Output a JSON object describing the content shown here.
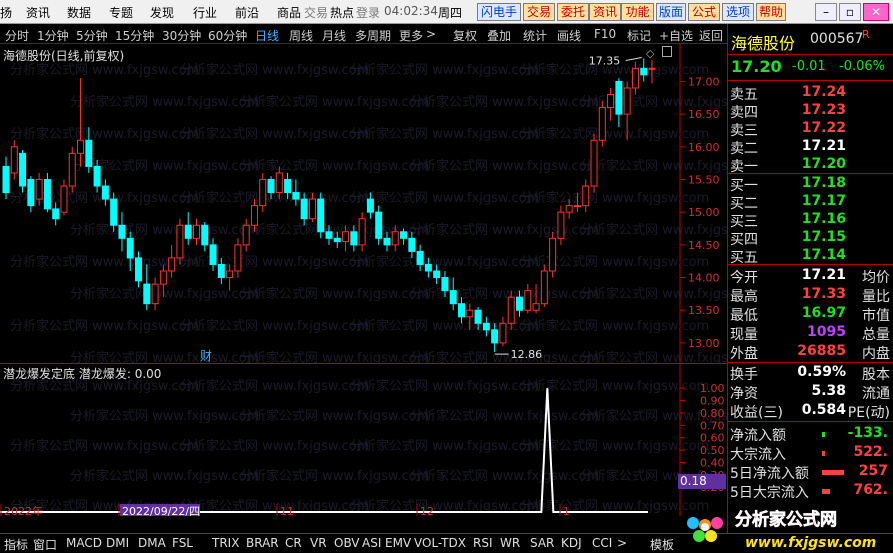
{
  "menubar": {
    "items": [
      "扬",
      "资讯",
      "数据",
      "专题",
      "发现",
      "行业",
      "前沿",
      "商品",
      "交易",
      "热点",
      "登录"
    ],
    "time": "04:02:34",
    "weekday": "周四",
    "buttons": [
      {
        "label": "闪电手",
        "bg": "#dde8ff",
        "fg": "#0040c0"
      },
      {
        "label": "交易",
        "bg": "#ffe0a0",
        "fg": "#c00000"
      },
      {
        "label": "委托",
        "bg": "#ffe0a0",
        "fg": "#c00000"
      },
      {
        "label": "资讯",
        "bg": "#ffe0a0",
        "fg": "#c00000"
      },
      {
        "label": "功能",
        "bg": "#ffe0a0",
        "fg": "#c00000"
      },
      {
        "label": "版面",
        "bg": "#dde8ff",
        "fg": "#0040c0"
      },
      {
        "label": "公式",
        "bg": "#ffe0a0",
        "fg": "#c00000"
      },
      {
        "label": "选项",
        "bg": "#dde8ff",
        "fg": "#0040c0"
      },
      {
        "label": "帮助",
        "bg": "#ffe0a0",
        "fg": "#c00000"
      }
    ],
    "window_controls": [
      "minimize-icon",
      "restore-icon",
      "close-icon"
    ]
  },
  "periodbar": {
    "periods": [
      "分时",
      "1分钟",
      "5分钟",
      "15分钟",
      "30分钟",
      "60分钟",
      "日线",
      "周线",
      "月线",
      "多周期",
      "更多"
    ],
    "active": "日线",
    "more_symbol": ">",
    "tools": [
      "复权",
      "叠加",
      "统计",
      "画线",
      "F10",
      "标记",
      "+自选",
      "返回"
    ]
  },
  "chart": {
    "title": "海德股份(日线,前复权)",
    "y_ticks": [
      "17.00",
      "16.50",
      "16.00",
      "15.50",
      "15.00",
      "14.50",
      "14.00",
      "13.50",
      "13.00"
    ],
    "high_marker": "17.35",
    "low_marker": "12.86",
    "cai_badge": "财",
    "up_color": "#ff3030",
    "down_color": "#00ffff"
  },
  "chart_data": {
    "type": "candlestick",
    "title": "海德股份(日线,前复权)",
    "ylim": [
      12.8,
      17.45
    ],
    "candles": [
      {
        "o": 15.7,
        "h": 15.85,
        "l": 15.2,
        "c": 15.3
      },
      {
        "o": 15.6,
        "h": 16.1,
        "l": 15.5,
        "c": 16.0
      },
      {
        "o": 15.9,
        "h": 15.95,
        "l": 15.3,
        "c": 15.4
      },
      {
        "o": 15.5,
        "h": 15.55,
        "l": 15.0,
        "c": 15.1
      },
      {
        "o": 15.2,
        "h": 15.6,
        "l": 15.1,
        "c": 15.5
      },
      {
        "o": 15.5,
        "h": 15.6,
        "l": 15.0,
        "c": 15.05
      },
      {
        "o": 15.05,
        "h": 15.15,
        "l": 14.8,
        "c": 14.9
      },
      {
        "o": 15.0,
        "h": 15.5,
        "l": 14.95,
        "c": 15.4
      },
      {
        "o": 15.4,
        "h": 16.0,
        "l": 15.3,
        "c": 15.9
      },
      {
        "o": 15.9,
        "h": 17.05,
        "l": 15.7,
        "c": 16.1
      },
      {
        "o": 16.1,
        "h": 16.3,
        "l": 15.6,
        "c": 15.7
      },
      {
        "o": 15.7,
        "h": 15.8,
        "l": 15.3,
        "c": 15.4
      },
      {
        "o": 15.4,
        "h": 15.5,
        "l": 15.1,
        "c": 15.2
      },
      {
        "o": 15.2,
        "h": 15.3,
        "l": 14.7,
        "c": 14.8
      },
      {
        "o": 14.8,
        "h": 15.0,
        "l": 14.4,
        "c": 14.6
      },
      {
        "o": 14.6,
        "h": 14.7,
        "l": 14.1,
        "c": 14.3
      },
      {
        "o": 14.3,
        "h": 14.4,
        "l": 13.85,
        "c": 13.95
      },
      {
        "o": 13.9,
        "h": 14.2,
        "l": 13.5,
        "c": 13.6
      },
      {
        "o": 13.6,
        "h": 14.0,
        "l": 13.5,
        "c": 13.9
      },
      {
        "o": 13.9,
        "h": 14.2,
        "l": 13.7,
        "c": 14.1
      },
      {
        "o": 14.1,
        "h": 14.5,
        "l": 14.0,
        "c": 14.3
      },
      {
        "o": 14.3,
        "h": 14.9,
        "l": 14.2,
        "c": 14.8
      },
      {
        "o": 14.8,
        "h": 15.0,
        "l": 14.5,
        "c": 14.6
      },
      {
        "o": 14.6,
        "h": 14.9,
        "l": 14.5,
        "c": 14.8
      },
      {
        "o": 14.8,
        "h": 14.85,
        "l": 14.4,
        "c": 14.5
      },
      {
        "o": 14.5,
        "h": 14.6,
        "l": 14.1,
        "c": 14.2
      },
      {
        "o": 14.2,
        "h": 14.3,
        "l": 13.9,
        "c": 14.0
      },
      {
        "o": 14.0,
        "h": 14.2,
        "l": 13.8,
        "c": 14.1
      },
      {
        "o": 14.1,
        "h": 14.6,
        "l": 14.0,
        "c": 14.5
      },
      {
        "o": 14.5,
        "h": 14.9,
        "l": 14.4,
        "c": 14.8
      },
      {
        "o": 14.8,
        "h": 15.2,
        "l": 14.7,
        "c": 15.1
      },
      {
        "o": 15.1,
        "h": 15.6,
        "l": 15.0,
        "c": 15.5
      },
      {
        "o": 15.5,
        "h": 15.55,
        "l": 15.2,
        "c": 15.3
      },
      {
        "o": 15.3,
        "h": 15.7,
        "l": 15.2,
        "c": 15.6
      },
      {
        "o": 15.5,
        "h": 15.6,
        "l": 15.2,
        "c": 15.3
      },
      {
        "o": 15.3,
        "h": 15.5,
        "l": 15.1,
        "c": 15.2
      },
      {
        "o": 15.2,
        "h": 15.3,
        "l": 14.8,
        "c": 14.9
      },
      {
        "o": 14.9,
        "h": 15.3,
        "l": 14.85,
        "c": 15.2
      },
      {
        "o": 15.2,
        "h": 15.3,
        "l": 14.6,
        "c": 14.7
      },
      {
        "o": 14.7,
        "h": 14.8,
        "l": 14.5,
        "c": 14.6
      },
      {
        "o": 14.6,
        "h": 14.7,
        "l": 14.45,
        "c": 14.55
      },
      {
        "o": 14.55,
        "h": 14.8,
        "l": 14.4,
        "c": 14.7
      },
      {
        "o": 14.7,
        "h": 14.8,
        "l": 14.4,
        "c": 14.5
      },
      {
        "o": 14.5,
        "h": 15.0,
        "l": 14.4,
        "c": 14.9
      },
      {
        "o": 15.2,
        "h": 15.3,
        "l": 14.9,
        "c": 15.0
      },
      {
        "o": 15.0,
        "h": 15.1,
        "l": 14.5,
        "c": 14.6
      },
      {
        "o": 14.6,
        "h": 14.7,
        "l": 14.4,
        "c": 14.5
      },
      {
        "o": 14.5,
        "h": 14.8,
        "l": 14.4,
        "c": 14.7
      },
      {
        "o": 14.7,
        "h": 14.75,
        "l": 14.5,
        "c": 14.6
      },
      {
        "o": 14.6,
        "h": 14.7,
        "l": 14.3,
        "c": 14.4
      },
      {
        "o": 14.4,
        "h": 14.5,
        "l": 14.1,
        "c": 14.2
      },
      {
        "o": 14.2,
        "h": 14.3,
        "l": 14.0,
        "c": 14.1
      },
      {
        "o": 14.1,
        "h": 14.2,
        "l": 13.9,
        "c": 14.0
      },
      {
        "o": 14.0,
        "h": 14.1,
        "l": 13.7,
        "c": 13.8
      },
      {
        "o": 13.8,
        "h": 14.0,
        "l": 13.5,
        "c": 13.6
      },
      {
        "o": 13.6,
        "h": 13.7,
        "l": 13.3,
        "c": 13.4
      },
      {
        "o": 13.4,
        "h": 13.6,
        "l": 13.2,
        "c": 13.5
      },
      {
        "o": 13.5,
        "h": 13.55,
        "l": 13.2,
        "c": 13.3
      },
      {
        "o": 13.3,
        "h": 13.4,
        "l": 13.1,
        "c": 13.2
      },
      {
        "o": 13.2,
        "h": 13.3,
        "l": 12.86,
        "c": 13.0
      },
      {
        "o": 13.0,
        "h": 13.4,
        "l": 12.95,
        "c": 13.3
      },
      {
        "o": 13.3,
        "h": 13.8,
        "l": 13.2,
        "c": 13.7
      },
      {
        "o": 13.7,
        "h": 13.8,
        "l": 13.4,
        "c": 13.5
      },
      {
        "o": 13.5,
        "h": 13.9,
        "l": 13.45,
        "c": 13.8
      },
      {
        "o": 13.5,
        "h": 13.9,
        "l": 13.45,
        "c": 13.6
      },
      {
        "o": 13.6,
        "h": 14.2,
        "l": 13.55,
        "c": 14.1
      },
      {
        "o": 14.1,
        "h": 14.7,
        "l": 14.0,
        "c": 14.6
      },
      {
        "o": 14.6,
        "h": 15.1,
        "l": 14.5,
        "c": 15.0
      },
      {
        "o": 15.0,
        "h": 15.2,
        "l": 14.9,
        "c": 15.1
      },
      {
        "o": 15.1,
        "h": 15.3,
        "l": 15.0,
        "c": 15.1
      },
      {
        "o": 15.1,
        "h": 15.5,
        "l": 15.0,
        "c": 15.4
      },
      {
        "o": 15.4,
        "h": 16.2,
        "l": 15.3,
        "c": 16.1
      },
      {
        "o": 16.1,
        "h": 16.7,
        "l": 16.0,
        "c": 16.6
      },
      {
        "o": 16.6,
        "h": 16.9,
        "l": 16.4,
        "c": 16.8
      },
      {
        "o": 17.0,
        "h": 17.05,
        "l": 16.3,
        "c": 16.5
      },
      {
        "o": 16.5,
        "h": 17.0,
        "l": 16.1,
        "c": 16.9
      },
      {
        "o": 16.9,
        "h": 17.3,
        "l": 16.8,
        "c": 17.2
      },
      {
        "o": 17.2,
        "h": 17.35,
        "l": 17.0,
        "c": 17.1
      },
      {
        "o": 17.2,
        "h": 17.33,
        "l": 16.97,
        "c": 17.2
      }
    ],
    "indicator": {
      "name": "潜龙爆发定底",
      "label": "潜龙爆发: 0.00",
      "y_ticks": [
        "1.00",
        "0.90",
        "0.80",
        "0.70",
        "0.60",
        "0.50",
        "0.40",
        "0.30",
        "0.20"
      ],
      "values_spike_index": 65,
      "ylim": [
        0,
        1.05
      ]
    },
    "x_labels": [
      "2022年",
      "2022/09/22/四",
      "11",
      "12",
      "1"
    ]
  },
  "indicator_tag": "0.18",
  "panel": {
    "name": "海德股份",
    "code": "000567",
    "r_mark": "R",
    "price": "17.20",
    "change": "-0.01",
    "pct": "-0.06%",
    "sells": [
      {
        "label": "卖五",
        "price": "17.24"
      },
      {
        "label": "卖四",
        "price": "17.23"
      },
      {
        "label": "卖三",
        "price": "17.22"
      },
      {
        "label": "卖二",
        "price": "17.21"
      },
      {
        "label": "卖一",
        "price": "17.20"
      }
    ],
    "buys": [
      {
        "label": "买一",
        "price": "17.18"
      },
      {
        "label": "买二",
        "price": "17.17"
      },
      {
        "label": "买三",
        "price": "17.16"
      },
      {
        "label": "买四",
        "price": "17.15"
      },
      {
        "label": "买五",
        "price": "17.14"
      }
    ],
    "stats": [
      {
        "label": "今开",
        "value": "17.21",
        "label2": "均价",
        "color": "white"
      },
      {
        "label": "最高",
        "value": "17.33",
        "label2": "量比",
        "color": "red"
      },
      {
        "label": "最低",
        "value": "16.97",
        "label2": "市值",
        "color": "green"
      },
      {
        "label": "现量",
        "value": "1095",
        "label2": "总量",
        "color": "purple"
      },
      {
        "label": "外盘",
        "value": "26885",
        "label2": "内盘",
        "color": "red"
      }
    ],
    "stats2": [
      {
        "label": "换手",
        "value": "0.59%",
        "label2": "股本",
        "color": "white"
      },
      {
        "label": "净资",
        "value": "5.38",
        "label2": "流通",
        "color": "white"
      },
      {
        "label": "收益(三)",
        "value": "0.584",
        "label2": "PE(动)",
        "color": "white"
      }
    ],
    "flows": [
      {
        "label": "净流入额",
        "value": "-133.",
        "color": "green"
      },
      {
        "label": "大宗流入",
        "value": "522.",
        "color": "red"
      },
      {
        "label": "5日净流入额",
        "value": "257",
        "color": "red"
      },
      {
        "label": "5日大宗流入",
        "value": "762.",
        "color": "red"
      }
    ]
  },
  "tabs": [
    "指标",
    "窗口",
    "MACD",
    "DMI",
    "DMA",
    "FSL",
    "TRIX",
    "BRAR",
    "CR",
    "VR",
    "OBV",
    "ASI",
    "EMV",
    "VOL-TDX",
    "RSI",
    "WR",
    "SAR",
    "KDJ",
    "CCI",
    ">",
    "模板"
  ],
  "watermark": {
    "text": "分析家公式网",
    "url": "www.fxjgsw.com",
    "repeat_text": "分析家公式网 www.fxjgsw.com"
  }
}
